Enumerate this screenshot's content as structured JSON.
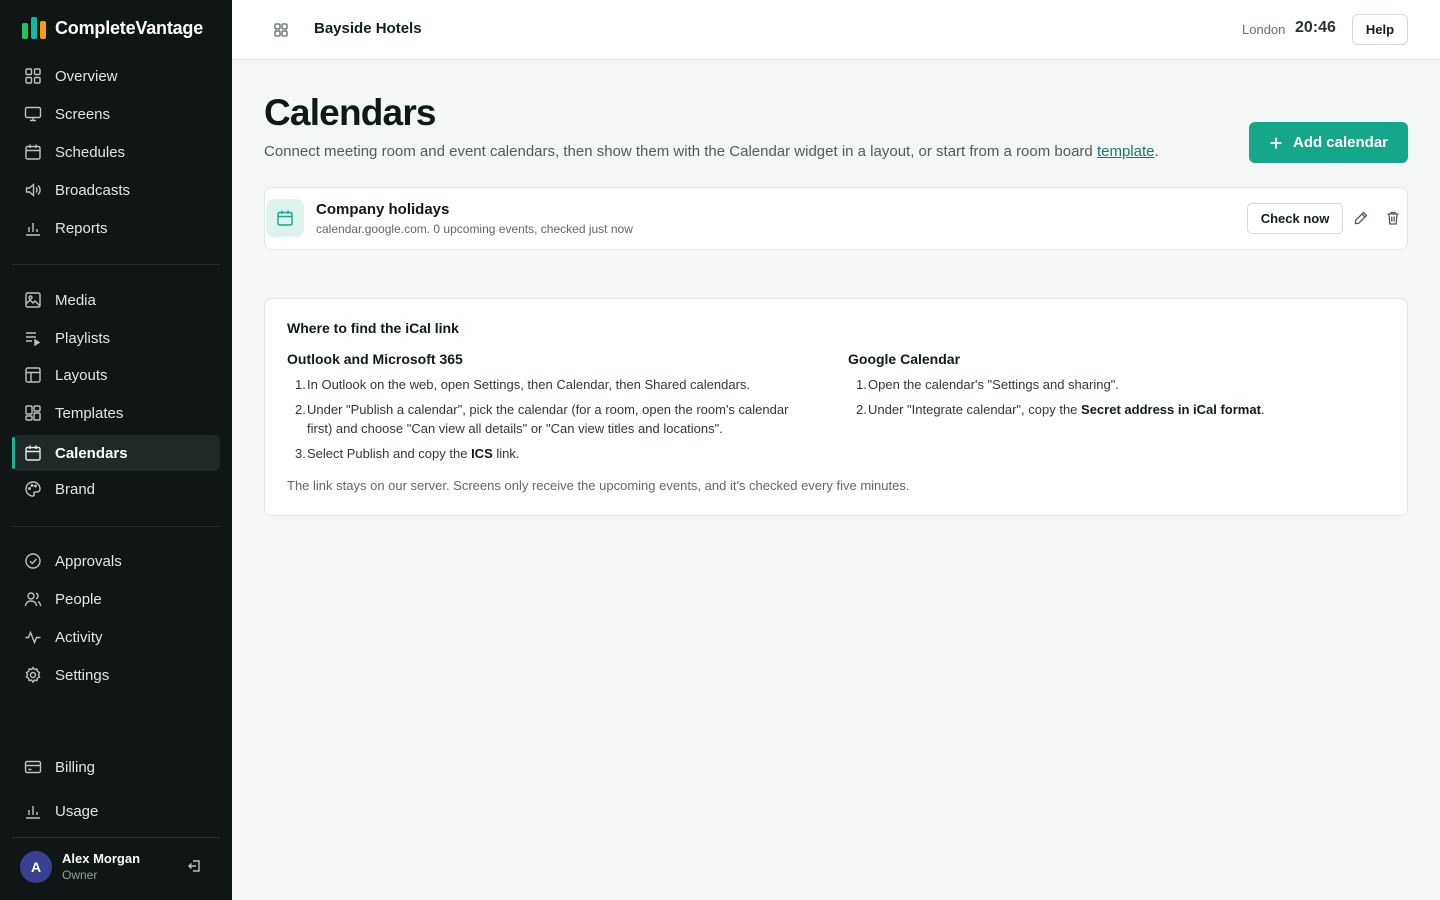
{
  "brand": {
    "name": "CompleteVantage",
    "logo_colors": [
      "#22c55e",
      "#14b8a6",
      "#f59e0b"
    ]
  },
  "colors": {
    "accent": "#14a78a",
    "sidebar_bg": "#0f1615",
    "avatar_bg": "#3b3f8f"
  },
  "sidebar": {
    "items": [
      {
        "label": "Overview",
        "icon": "grid-icon"
      },
      {
        "label": "Screens",
        "icon": "monitor-icon"
      },
      {
        "label": "Schedules",
        "icon": "calendar-icon"
      },
      {
        "label": "Broadcasts",
        "icon": "speaker-icon"
      },
      {
        "label": "Reports",
        "icon": "bar-chart-icon"
      },
      {
        "label": "Media",
        "icon": "image-icon"
      },
      {
        "label": "Playlists",
        "icon": "playlist-icon"
      },
      {
        "label": "Layouts",
        "icon": "layout-icon"
      },
      {
        "label": "Templates",
        "icon": "templates-icon"
      },
      {
        "label": "Calendars",
        "icon": "calendar-icon",
        "active": true
      },
      {
        "label": "Brand",
        "icon": "palette-icon"
      },
      {
        "label": "Approvals",
        "icon": "check-circle-icon"
      },
      {
        "label": "People",
        "icon": "users-icon"
      },
      {
        "label": "Activity",
        "icon": "activity-icon"
      },
      {
        "label": "Settings",
        "icon": "gear-icon"
      },
      {
        "label": "Billing",
        "icon": "credit-card-icon"
      },
      {
        "label": "Usage",
        "icon": "bar-chart-icon"
      }
    ]
  },
  "user": {
    "initial": "A",
    "name": "Alex Morgan",
    "role": "Owner"
  },
  "topbar": {
    "org_name": "Bayside Hotels",
    "city": "London",
    "time": "20:46",
    "help_label": "Help"
  },
  "page": {
    "title": "Calendars",
    "description": "Connect meeting room and event calendars, then show them with the Calendar widget in a layout, or start from a room board ",
    "description_link": "template",
    "description_end": ".",
    "add_button": "Add calendar"
  },
  "calendars": [
    {
      "name": "Company holidays",
      "meta": "calendar.google.com. 0 upcoming events, checked just now",
      "check_label": "Check now"
    }
  ],
  "help_card": {
    "title": "Where to find the iCal link",
    "outlook": {
      "title": "Outlook and Microsoft 365",
      "steps": [
        {
          "n": "1.",
          "text": "In Outlook on the web, open Settings, then Calendar, then Shared calendars."
        },
        {
          "n": "2.",
          "text_a": "Under \"Publish a calendar\", pick the calendar (for a room, open the room's calendar",
          "text_b": "first) and choose \"Can view all details\" or \"Can view titles and locations\"."
        },
        {
          "n": "3.",
          "pre": "Select Publish and copy the ",
          "bold": "ICS",
          "post": " link."
        }
      ]
    },
    "google": {
      "title": "Google Calendar",
      "steps": [
        {
          "n": "1.",
          "text": "Open the calendar's \"Settings and sharing\"."
        },
        {
          "n": "2.",
          "pre": "Under \"Integrate calendar\", copy the ",
          "bold": "Secret address in iCal format",
          "post": "."
        }
      ]
    },
    "footnote": "The link stays on our server. Screens only receive the upcoming events, and it's checked every five minutes."
  }
}
